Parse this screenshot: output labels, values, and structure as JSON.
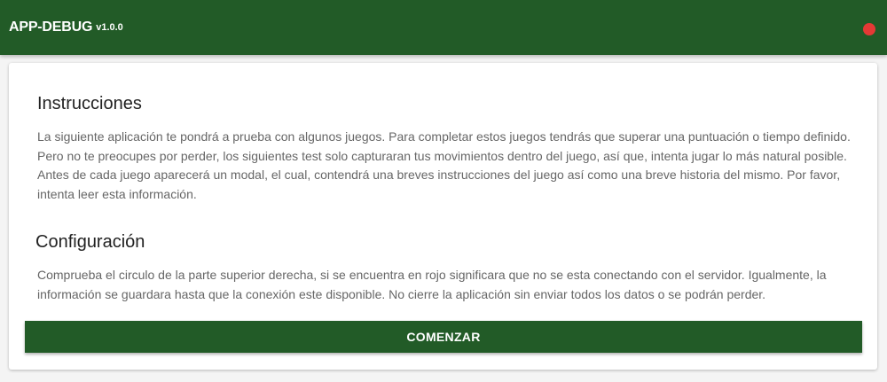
{
  "header": {
    "title": "APP-DEBUG",
    "version": "v1.0.0",
    "connection_status_color": "#e53935"
  },
  "instructions": {
    "title": "Instrucciones",
    "paragraph_1": "La siguiente aplicación te pondrá a prueba con algunos juegos. Para completar estos juegos tendrás que superar una puntuación o tiempo definido. Pero no te preocupes por perder, los siguientes test solo capturaran tus movimientos dentro del juego, así que, intenta jugar lo más natural posible.",
    "paragraph_2": "Antes de cada juego aparecerá un modal, el cual, contendrá una breves instrucciones del juego así como una breve historia del mismo. Por favor, intenta leer esta información."
  },
  "configuration": {
    "title": "Configuración",
    "paragraph": "Comprueba el circulo de la parte superior derecha, si se encuentra en rojo significara que no se esta conectando con el servidor. Igualmente, la información se guardara hasta que la conexión este disponible. No cierre la aplicación sin enviar todos los datos o se podrán perder."
  },
  "actions": {
    "start_label": "COMENZAR"
  },
  "colors": {
    "primary": "#225b27",
    "status_disconnected": "#e53935"
  }
}
